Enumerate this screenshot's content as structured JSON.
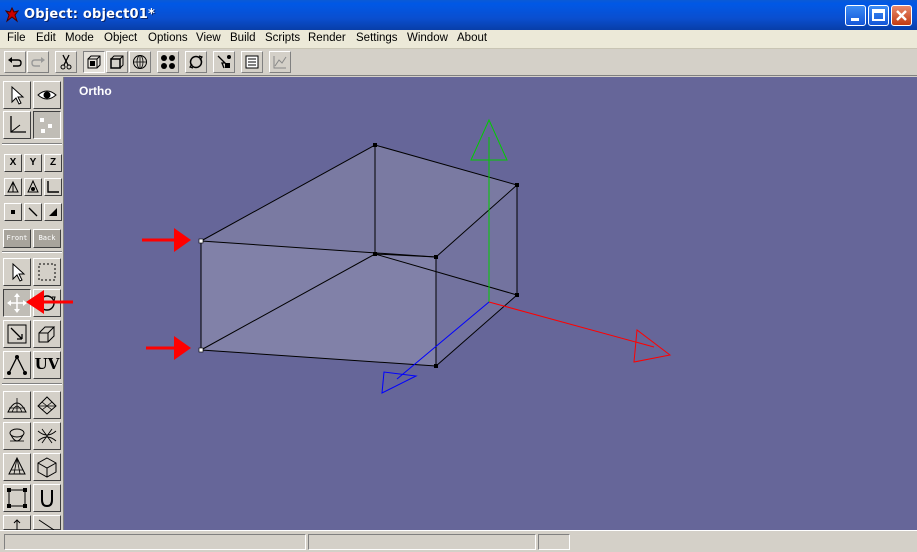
{
  "window": {
    "title": "Object: object01*",
    "icon": "app-icon",
    "controls": [
      "minimize-icon",
      "maximize-icon",
      "close-icon"
    ]
  },
  "menu": {
    "items": [
      "File",
      "Edit",
      "Mode",
      "Object",
      "Options",
      "View",
      "Build",
      "Scripts",
      "Render",
      "Settings",
      "Window",
      "About"
    ]
  },
  "toolbar": {
    "buttons": [
      "undo-icon",
      "redo-icon",
      "cut-icon",
      "vertex-mode-icon",
      "edge-mode-icon",
      "face-mode-icon",
      "points-icon",
      "rotate-view-icon",
      "select-mode-icon",
      "list-icon",
      "graph-icon"
    ]
  },
  "palette": {
    "axis_buttons": [
      "X",
      "Y",
      "Z"
    ],
    "front_label": "Front",
    "back_label": "Back",
    "uv_label": "UV"
  },
  "viewport": {
    "label": "Ortho",
    "background": "#666699",
    "axis_colors": {
      "x": "#ff0000",
      "y": "#00cc00",
      "z": "#0000ff"
    }
  },
  "status": {
    "left": "",
    "middle": "",
    "right": ""
  }
}
